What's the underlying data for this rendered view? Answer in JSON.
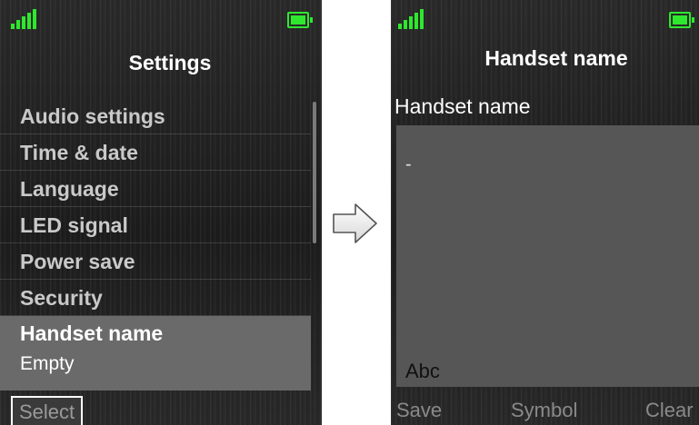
{
  "left_screen": {
    "title": "Settings",
    "menu": [
      {
        "label": "Audio settings"
      },
      {
        "label": "Time & date"
      },
      {
        "label": "Language"
      },
      {
        "label": "LED signal"
      },
      {
        "label": "Power save"
      },
      {
        "label": "Security"
      }
    ],
    "selected_item": {
      "label": "Handset name",
      "value": "Empty"
    },
    "softkey_left": "Select"
  },
  "right_screen": {
    "title": "Handset name",
    "field_label": "Handset name",
    "field_value": "",
    "cursor": "-",
    "input_mode": "Abc",
    "softkeys": {
      "left": "Save",
      "middle": "Symbol",
      "right": "Clear"
    }
  },
  "icons": {
    "signal": "signal-strength-icon",
    "battery": "battery-icon",
    "transition": "right-arrow-icon"
  },
  "colors": {
    "status_green": "#2ee82e",
    "highlight": "#6a6a6a",
    "text_box": "#565656"
  }
}
